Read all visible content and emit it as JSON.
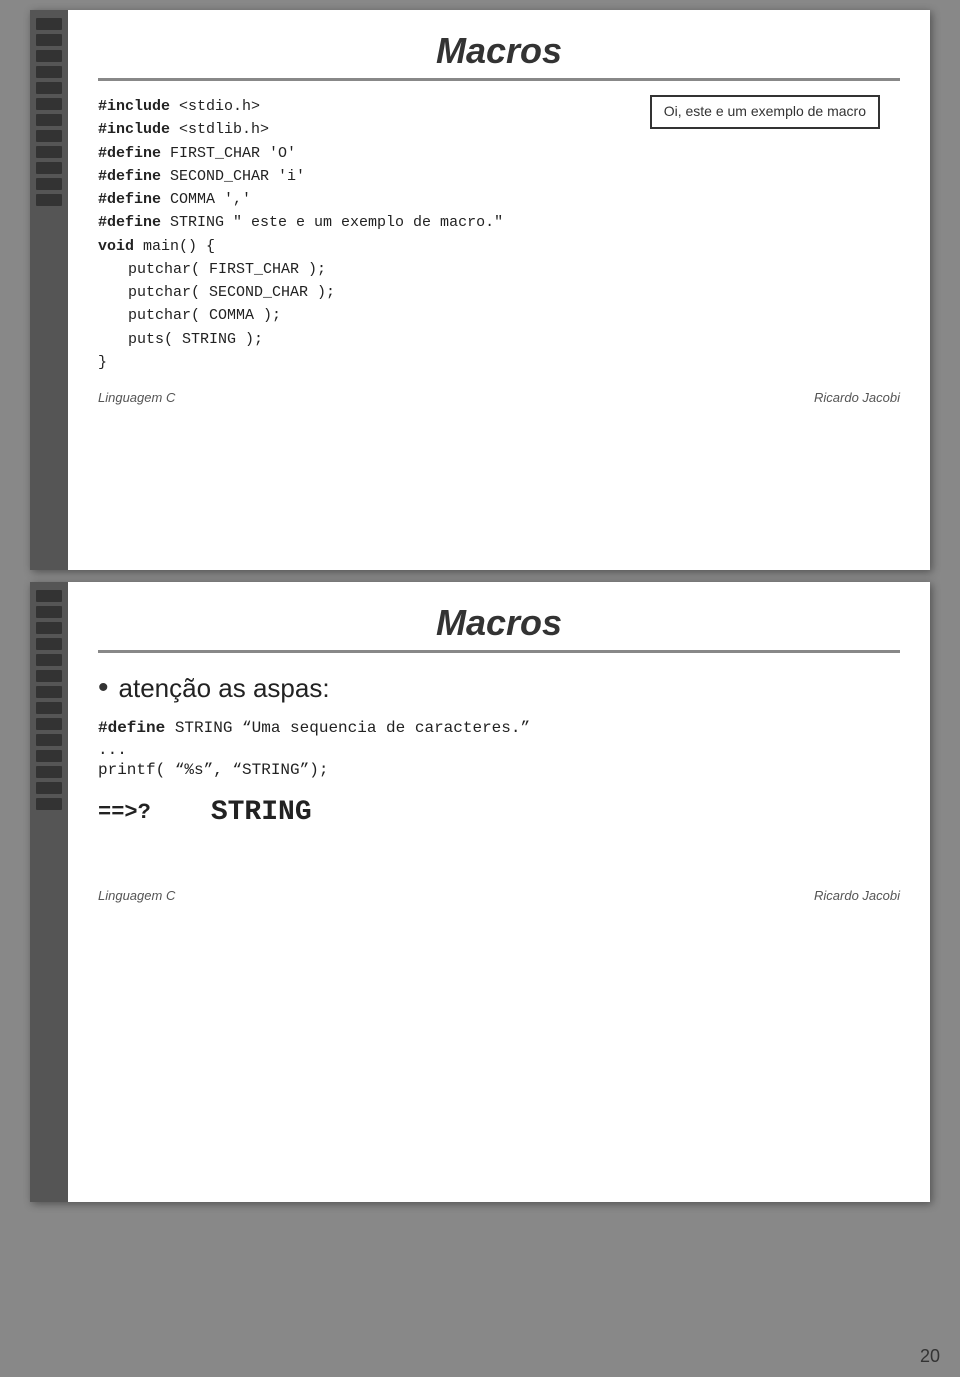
{
  "slide1": {
    "title": "Macros",
    "callout": "Oi, este e um exemplo de macro",
    "code_lines": [
      {
        "type": "include",
        "bold": "#include",
        "rest": " <stdio.h>"
      },
      {
        "type": "include",
        "bold": "#include",
        "rest": " <stdlib.h>"
      },
      {
        "type": "define",
        "bold": "#define",
        "rest": " FIRST_CHAR 'O'"
      },
      {
        "type": "define",
        "bold": "#define",
        "rest": " SECOND_CHAR 'i'"
      },
      {
        "type": "define",
        "bold": "#define",
        "rest": " COMMA ','"
      },
      {
        "type": "define",
        "bold": "#define",
        "rest": " STRING \" este e um exemplo de macro.\""
      },
      {
        "type": "plain",
        "bold": "void",
        "rest": " main() {"
      },
      {
        "type": "indented",
        "rest": "putchar( FIRST_CHAR );"
      },
      {
        "type": "indented",
        "rest": "putchar( SECOND_CHAR );"
      },
      {
        "type": "indented",
        "rest": "putchar( COMMA );"
      },
      {
        "type": "indented",
        "rest": "puts( STRING );"
      },
      {
        "type": "plain",
        "rest": "}"
      }
    ],
    "footer_left": "Linguagem C",
    "footer_right": "Ricardo Jacobi"
  },
  "slide2": {
    "title": "Macros",
    "bullet_text": "atenção as aspas:",
    "define_line_bold": "#define",
    "define_line_rest": " STRING “Uma sequencia de caracteres.”",
    "ellipsis": "...",
    "printf_line": "printf( “%s”, “STRING”);",
    "arrow": "==>?",
    "result": "STRING",
    "footer_left": "Linguagem C",
    "footer_right": "Ricardo Jacobi"
  },
  "page_number": "20"
}
